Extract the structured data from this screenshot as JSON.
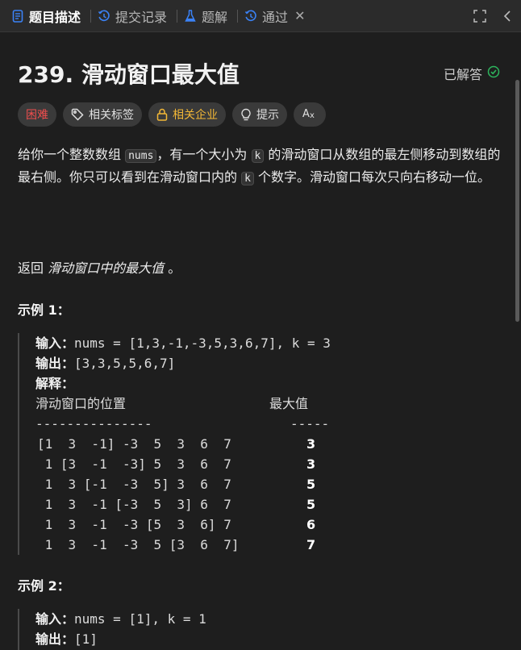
{
  "tabs": [
    {
      "label": "题目描述",
      "icon": "doc-icon",
      "active": true
    },
    {
      "label": "提交记录",
      "icon": "history-icon"
    },
    {
      "label": "题解",
      "icon": "flask-icon"
    },
    {
      "label": "通过",
      "icon": "history-icon",
      "closable": true,
      "close": "✕"
    }
  ],
  "header": {
    "title": "239. 滑动窗口最大值",
    "status": "已解答"
  },
  "tags": [
    {
      "label": "困难",
      "kind": "hard"
    },
    {
      "label": "相关标签",
      "icon": "tag-icon"
    },
    {
      "label": "相关企业",
      "icon": "lock-icon",
      "kind": "company"
    },
    {
      "label": "提示",
      "icon": "bulb-icon"
    },
    {
      "label": "",
      "icon": "translate-icon"
    }
  ],
  "description": {
    "p1a": "给你一个整数数组 ",
    "code_nums": "nums",
    "p1b": "，有一个大小为 ",
    "code_k": "k",
    "p1c": " 的滑动窗口从数组的最左侧移动到数组的最右侧。你只可以看到在滑动窗口内的 ",
    "code_k2": "k",
    "p1d": " 个数字。滑动窗口每次只向右移动一位。",
    "return_prefix": "返回 ",
    "return_em": "滑动窗口中的最大值",
    "return_suffix": " 。"
  },
  "example1": {
    "title": "示例 1：",
    "input_label": "输入：",
    "input_value": "nums = [1,3,-1,-3,5,3,6,7], k = 3",
    "output_label": "输出：",
    "output_value": "[3,3,5,5,6,7]",
    "explain_label": "解释：",
    "col_window": "滑动窗口的位置",
    "col_max": "最大值",
    "dash_left": "---------------",
    "dash_right": "-----",
    "rows": [
      {
        "window": "[1  3  -1] -3  5  3  6  7",
        "max": "3"
      },
      {
        "window": " 1 [3  -1  -3] 5  3  6  7",
        "max": "3"
      },
      {
        "window": " 1  3 [-1  -3  5] 3  6  7",
        "max": "5"
      },
      {
        "window": " 1  3  -1 [-3  5  3] 6  7",
        "max": "5"
      },
      {
        "window": " 1  3  -1  -3 [5  3  6] 7",
        "max": "6"
      },
      {
        "window": " 1  3  -1  -3  5 [3  6  7]",
        "max": "7"
      }
    ]
  },
  "example2": {
    "title": "示例 2：",
    "input_label": "输入：",
    "input_value": "nums = [1], k = 1",
    "output_label": "输出：",
    "output_value": "[1]"
  },
  "colors": {
    "hard": "#f04e4e",
    "company": "#f2b736",
    "solved": "#2db55d",
    "tab_icon_active": "#3b82f6"
  }
}
